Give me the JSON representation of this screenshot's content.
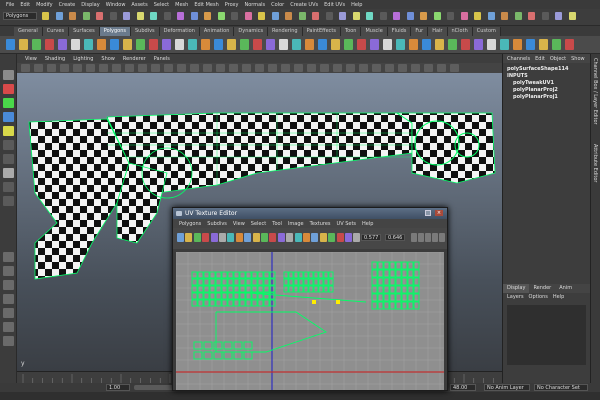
{
  "menubar": [
    "File",
    "Edit",
    "Modify",
    "Create",
    "Display",
    "Window",
    "Assets",
    "Select",
    "Mesh",
    "Edit Mesh",
    "Proxy",
    "Normals",
    "Color",
    "Create UVs",
    "Edit UVs",
    "Help"
  ],
  "mode_selector": "Polygons",
  "shelf_tabs": [
    "General",
    "Curves",
    "Surfaces",
    "Polygons",
    "Subdivs",
    "Deformation",
    "Animation",
    "Dynamics",
    "Rendering",
    "PaintEffects",
    "Toon",
    "Muscle",
    "Fluids",
    "Fur",
    "Hair",
    "nCloth",
    "Custom"
  ],
  "active_shelf_tab": "Polygons",
  "panel_menu": [
    "View",
    "Shading",
    "Lighting",
    "Show",
    "Renderer",
    "Panels"
  ],
  "channel_box": {
    "menu": [
      "Channels",
      "Edit",
      "Object",
      "Show"
    ],
    "shape": "polySurfaceShape114",
    "inputs_label": "INPUTS",
    "inputs": [
      "polyTweakUV1",
      "polyPlanarProj2",
      "polyPlanarProj1"
    ]
  },
  "side_tabs": [
    "Channel Box / Layer Editor",
    "Attribute Editor"
  ],
  "layer_editor": {
    "tabs": [
      "Display",
      "Render",
      "Anim"
    ],
    "active_tab": "Display",
    "menu": [
      "Layers",
      "Options",
      "Help"
    ]
  },
  "uv_editor": {
    "title": "UV Texture Editor",
    "menu": [
      "Polygons",
      "Subdivs",
      "View",
      "Select",
      "Tool",
      "Image",
      "Textures",
      "UV Sets",
      "Help"
    ],
    "field_u": "0.577",
    "field_v": "0.646"
  },
  "range": {
    "start": "1.00",
    "end": "48.00"
  },
  "anim_layer": "No Anim Layer",
  "character_set": "No Character Set",
  "axis_labels": {
    "y": "y",
    "x": "x"
  },
  "colors": {
    "accent": "#6a7a8c",
    "wire": "#00ff66",
    "uv_bg": "#8f8f8f"
  }
}
